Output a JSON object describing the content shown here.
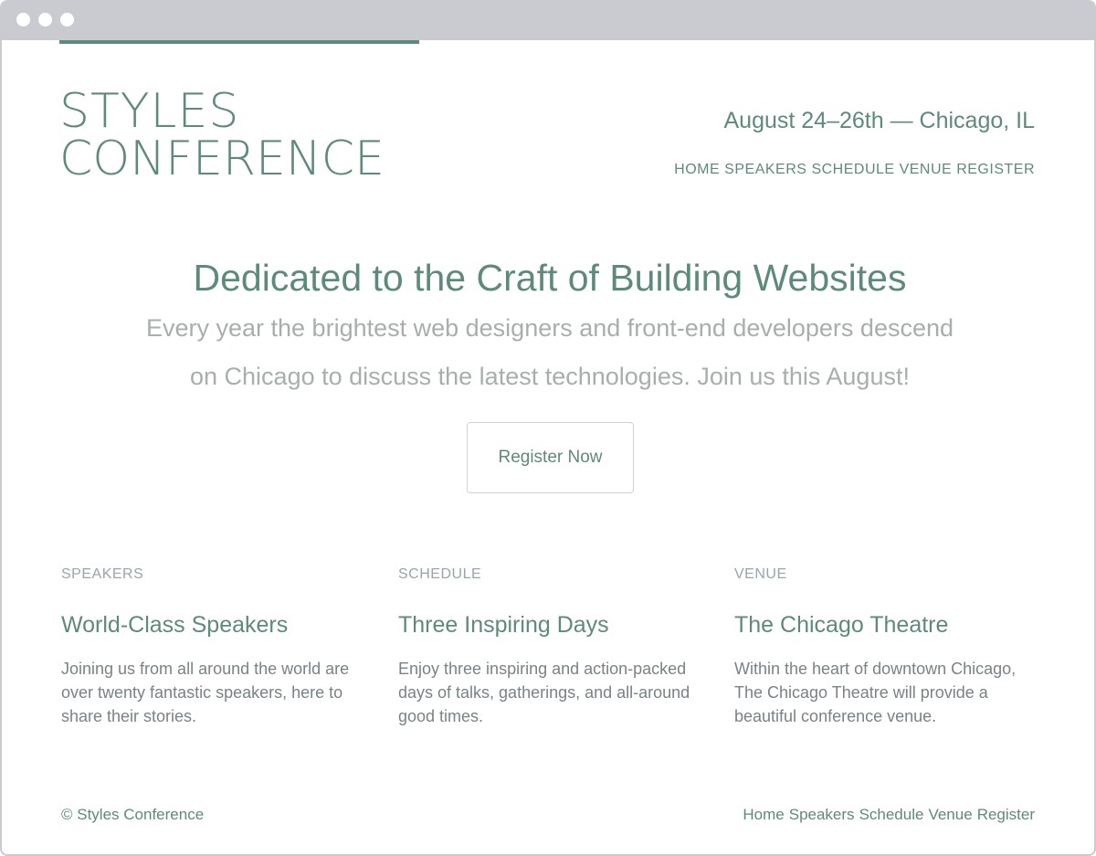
{
  "brand": {
    "logo_line1": "STYLES",
    "logo_line2": "CONFERENCE"
  },
  "event_info": "August 24–26th — Chicago, IL",
  "nav": {
    "items": [
      "HOME",
      "SPEAKERS",
      "SCHEDULE",
      "VENUE",
      "REGISTER"
    ]
  },
  "hero": {
    "title": "Dedicated to the Craft of Building Websites",
    "subtitle": "Every year the brightest web designers and front-end developers descend on Chicago to discuss the latest technologies. Join us this August!",
    "cta_label": "Register Now"
  },
  "features": [
    {
      "label": "SPEAKERS",
      "heading": "World-Class Speakers",
      "body": "Joining us from all around the world are over twenty fantastic speakers, here to share their stories."
    },
    {
      "label": "SCHEDULE",
      "heading": "Three Inspiring Days",
      "body": "Enjoy three inspiring and action-packed days of talks, gatherings, and all-around good times."
    },
    {
      "label": "VENUE",
      "heading": "The Chicago Theatre",
      "body": "Within the heart of downtown Chicago, The Chicago Theatre will provide a beautiful conference venue."
    }
  ],
  "footer": {
    "copyright": "© Styles Conference",
    "nav": [
      "Home",
      "Speakers",
      "Schedule",
      "Venue",
      "Register"
    ]
  },
  "colors": {
    "accent": "#5e8a7b",
    "muted_text": "#a8aeae",
    "body_text": "#7a8287",
    "label_text": "#9aa4aa",
    "window_chrome": "#c9cbd0"
  }
}
